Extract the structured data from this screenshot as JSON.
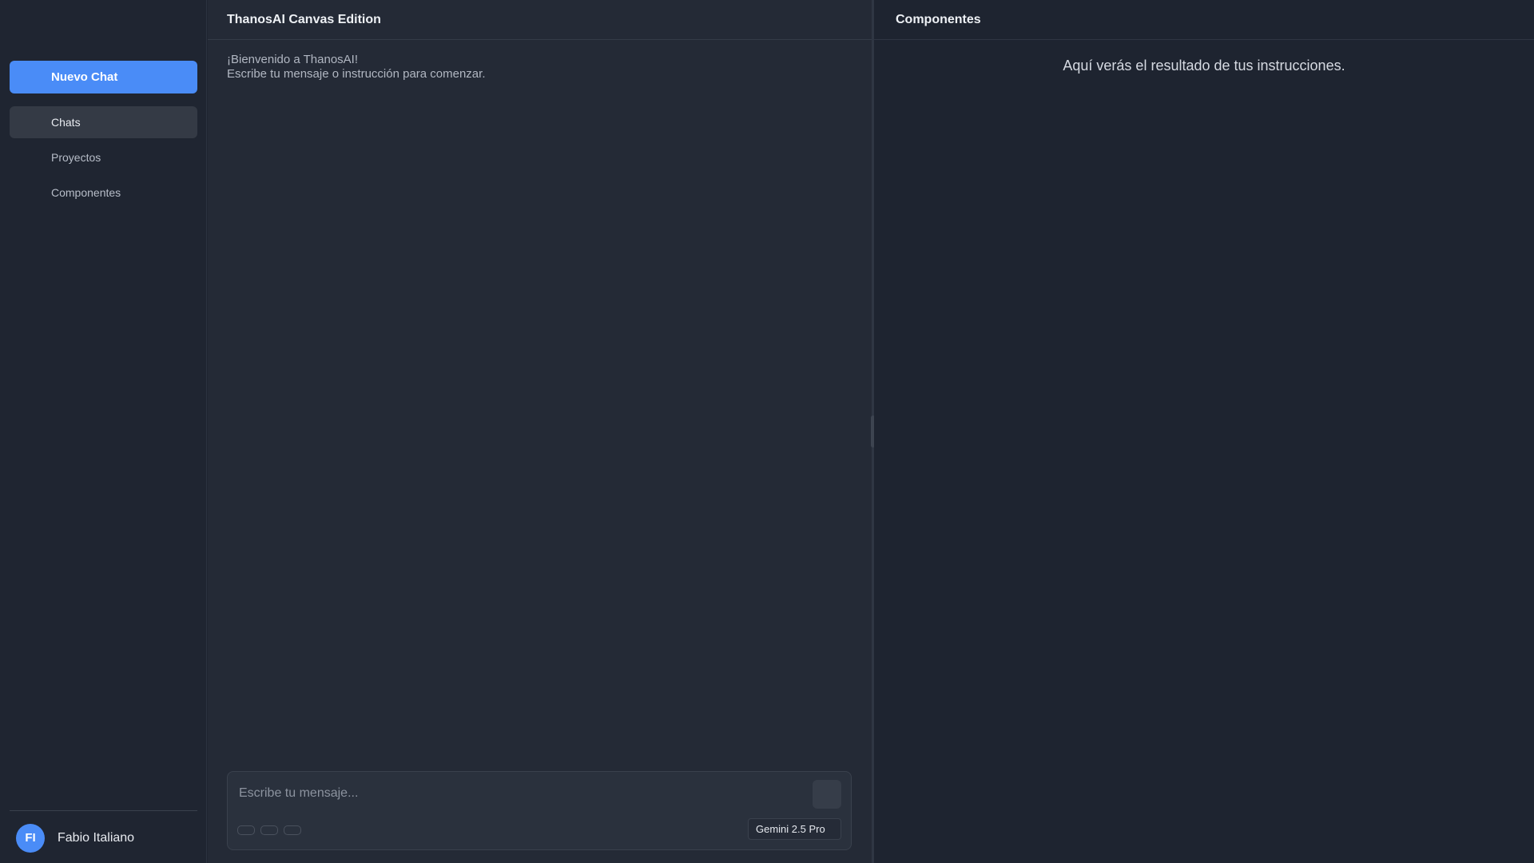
{
  "sidebar": {
    "new_chat_label": "Nuevo Chat",
    "items": [
      {
        "label": "Chats",
        "active": true
      },
      {
        "label": "Proyectos",
        "active": false
      },
      {
        "label": "Componentes",
        "active": false
      }
    ],
    "user": {
      "initials": "FI",
      "name": "Fabio Italiano"
    }
  },
  "chat": {
    "title": "ThanosAI Canvas Edition",
    "welcome_line1": "¡Bienvenido a ThanosAI!",
    "welcome_line2": "Escribe tu mensaje o instrucción para comenzar.",
    "input_placeholder": "Escribe tu mensaje...",
    "model": "Gemini 2.5 Pro"
  },
  "preview": {
    "title": "Componentes",
    "message": "Aquí verás el resultado de tus instrucciones."
  },
  "colors": {
    "accent": "#4a8cf7",
    "background": "#1e2430",
    "panel": "#242a36"
  }
}
